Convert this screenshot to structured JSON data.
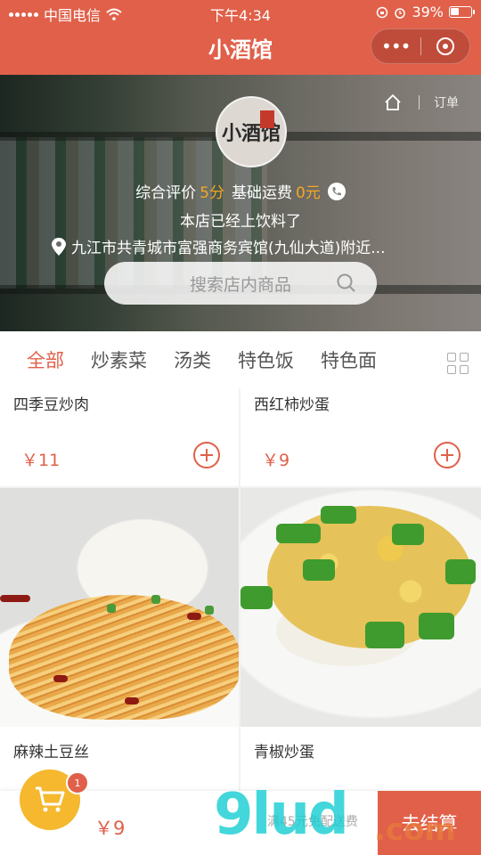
{
  "status_bar": {
    "carrier": "中国电信",
    "time": "下午4:34",
    "battery": "39%"
  },
  "nav": {
    "title": "小酒馆",
    "more_glyph": "•••"
  },
  "hero": {
    "orders_label": "订单",
    "logo_text": "小酒馆",
    "rating_label": "综合评价",
    "rating_value": "5分",
    "delivery_fee_label": "基础运费",
    "delivery_fee_value": "0元",
    "notice": "本店已经上饮料了",
    "address": "九江市共青城市富强商务宾馆(九仙大道)附近...",
    "search_placeholder": "搜索店内商品"
  },
  "categories": [
    "全部",
    "炒素菜",
    "汤类",
    "特色饭",
    "特色面"
  ],
  "products": [
    {
      "name": "四季豆炒肉",
      "price": "￥11"
    },
    {
      "name": "西红柿炒蛋",
      "price": "￥9"
    },
    {
      "name": "麻辣土豆丝"
    },
    {
      "name": "青椒炒蛋"
    }
  ],
  "cart": {
    "count": "1",
    "total": "￥9",
    "delivery_note": "满45元免配送费",
    "checkout_label": "去结算"
  },
  "watermark": {
    "main": "9lud",
    "suffix": ".com"
  },
  "colors": {
    "primary": "#e0604a",
    "cart": "#f5b82e",
    "price": "#e0604a"
  }
}
